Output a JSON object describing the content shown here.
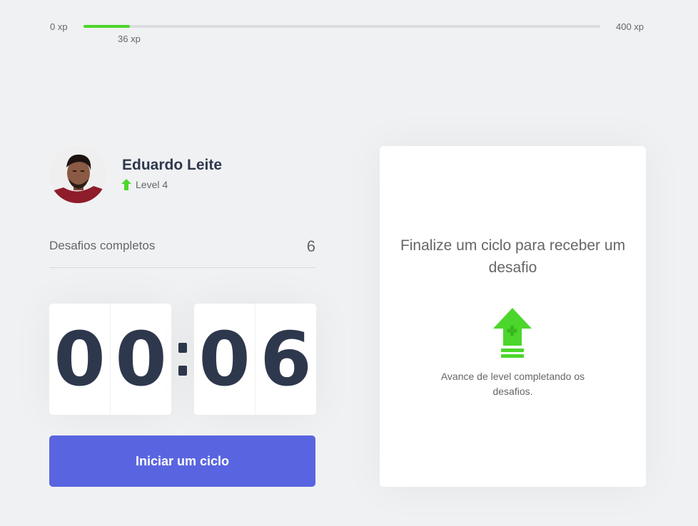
{
  "xp_bar": {
    "min_label": "0 xp",
    "max_label": "400 xp",
    "current_label": "36 xp",
    "progress_fraction": 0.09
  },
  "profile": {
    "name": "Eduardo Leite",
    "level_label": "Level 4"
  },
  "challenges": {
    "label": "Desafios completos",
    "count": "6"
  },
  "countdown": {
    "minute_left": "0",
    "minute_right": "0",
    "second_left": "0",
    "second_right": "6"
  },
  "actions": {
    "start_label": "Iniciar um ciclo"
  },
  "challenge_card": {
    "title": "Finalize um ciclo para receber um desafio",
    "text": "Avance de level completando os desafios."
  },
  "icons": {
    "level": "arrow-up-icon",
    "level_up": "level-up-icon"
  },
  "colors": {
    "accent": "#5965e0",
    "success": "#4cd62b",
    "title": "#2e384d",
    "text": "#666666",
    "background": "#f0f1f3"
  }
}
